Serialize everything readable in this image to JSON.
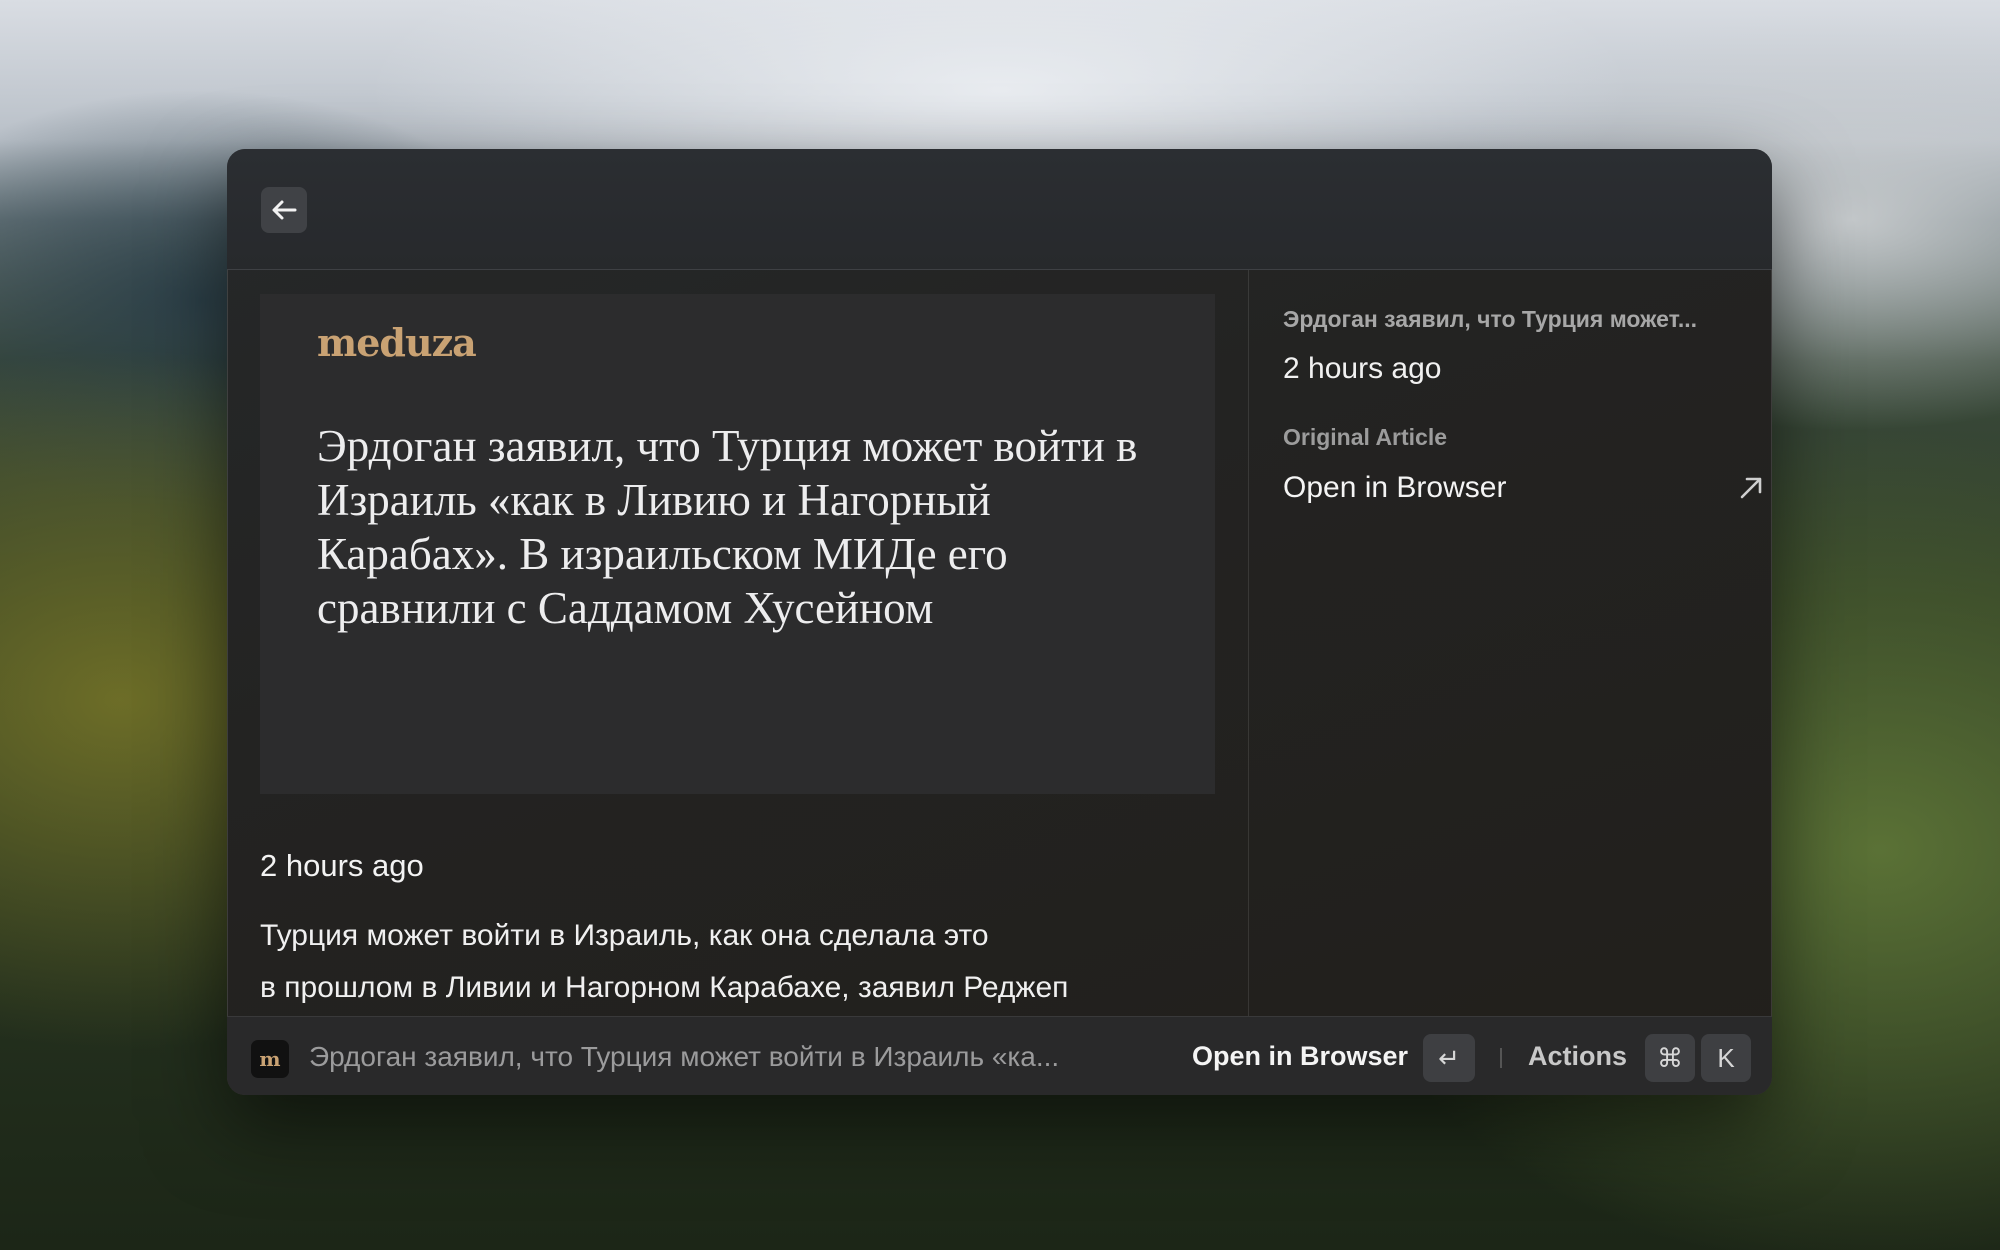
{
  "article": {
    "source_logo": "meduza",
    "headline": "Эрдоган заявил, что Турция может войти в Израиль «как в Ливию и Нагорный Карабах». В израильском МИДе его сравнили с Саддамом Хусейном",
    "time": "2 hours ago",
    "summary_line1": "Турция может войти в Израиль, как она сделала это",
    "summary_line2": "в прошлом в Ливии и Нагорном Карабахе, заявил Реджеп"
  },
  "metadata": {
    "title": "Эрдоган заявил, что Турция может...",
    "time": "2 hours ago",
    "original_label": "Original Article",
    "open_label": "Open in Browser"
  },
  "footer": {
    "favicon_letter": "m",
    "title": "Эрдоган заявил, что Турция может войти в Израиль «ка...",
    "primary_action": "Open in Browser",
    "enter_key": "↵",
    "actions_label": "Actions",
    "cmd_key": "⌘",
    "k_key": "K"
  }
}
